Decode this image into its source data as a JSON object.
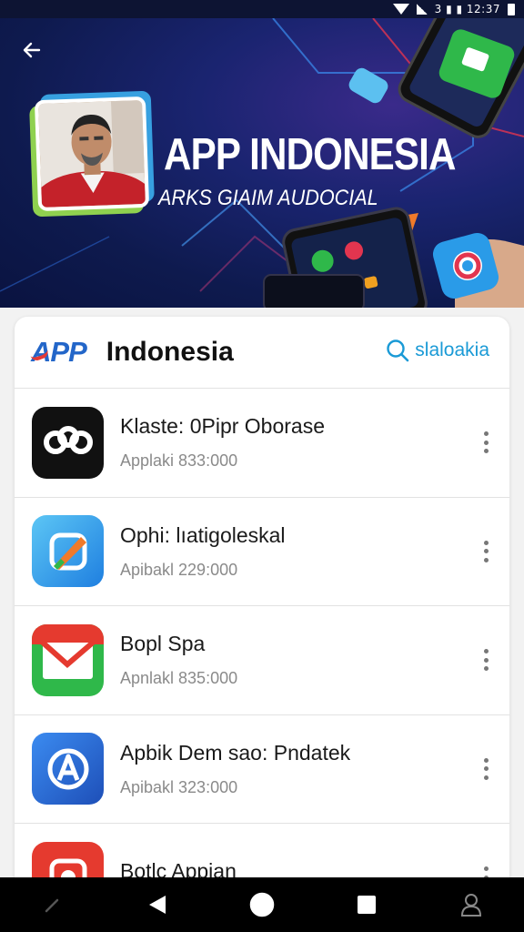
{
  "status_bar": {
    "text": "3 ▮ ▮ 12:37"
  },
  "hero": {
    "title": "APP INDONESIA",
    "subtitle": "ARKS GIAIM AUDOCIAL"
  },
  "header": {
    "brand_logo": "APP",
    "brand_name": "Indonesia",
    "search_label": "slaloakia"
  },
  "apps": [
    {
      "name": "Klaste: 0Pipr Oborase",
      "sub": "Applaki 833:000",
      "icon": "link-loop-icon",
      "color": "#111111"
    },
    {
      "name": "Ophi: lıatigoleskal",
      "sub": "Apibakl 229:000",
      "icon": "pencil-icon",
      "color": "#2f8fe6"
    },
    {
      "name": "Bopl Spa",
      "sub": "Apnlakl 835:000",
      "icon": "mail-envelope-icon",
      "color": "#2fb84a"
    },
    {
      "name": "Apbik Dem sao: Pndatek",
      "sub": "Apibakl 323:000",
      "icon": "letter-a-icon",
      "color": "#2560c8"
    },
    {
      "name": "Botlc Appian",
      "sub": "",
      "icon": "red-app-icon",
      "color": "#e53a2f"
    }
  ],
  "nav": {
    "items": [
      "edit-icon",
      "back-triangle-icon",
      "home-circle-icon",
      "recents-square-icon",
      "person-icon"
    ]
  },
  "colors": {
    "hero_bg": "#1a2470",
    "accent_blue": "#1a9ad6",
    "brand_blue": "#2366c9"
  }
}
